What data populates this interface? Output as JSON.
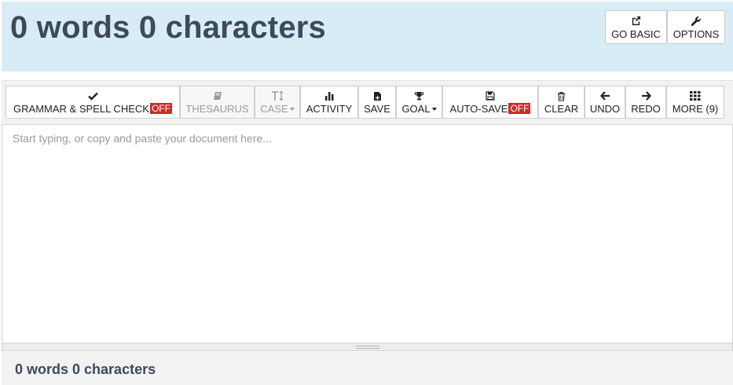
{
  "header": {
    "title": "0 words 0 characters",
    "go_basic_label": "GO BASIC",
    "options_label": "OPTIONS",
    "bg_color": "#d8ecf5"
  },
  "toolbar": {
    "grammar_label": "GRAMMAR & SPELL CHECK",
    "grammar_state": "OFF",
    "thesaurus_label": "THESAURUS",
    "case_label": "CASE",
    "activity_label": "ACTIVITY",
    "save_label": "SAVE",
    "goal_label": "GOAL",
    "autosave_label": "AUTO-SAVE",
    "autosave_state": "OFF",
    "clear_label": "CLEAR",
    "undo_label": "UNDO",
    "redo_label": "REDO",
    "more_label": "MORE (9)",
    "off_badge_color": "#cc2a2a",
    "icons": {
      "grammar": "check-icon",
      "thesaurus": "book-icon",
      "case": "text-height-icon",
      "activity": "bar-chart-icon",
      "save": "file-save-icon",
      "goal": "trophy-icon",
      "autosave": "floppy-disk-icon",
      "clear": "trash-icon",
      "undo": "arrow-left-icon",
      "redo": "arrow-right-icon",
      "more": "grid-icon",
      "go_basic": "external-link-icon",
      "options": "wrench-icon"
    }
  },
  "editor": {
    "placeholder": "Start typing, or copy and paste your document here...",
    "value": ""
  },
  "footer": {
    "status": "0 words 0 characters"
  }
}
